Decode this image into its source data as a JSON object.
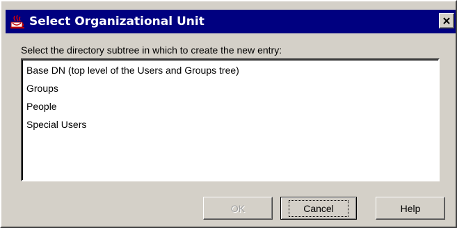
{
  "window": {
    "title": "Select Organizational Unit",
    "close_glyph": "close-icon",
    "app_icon": "java-app-icon"
  },
  "prompt": "Select the directory subtree in which to create the new entry:",
  "list": {
    "items": [
      {
        "label": "Base DN (top level of the Users and Groups tree)"
      },
      {
        "label": "Groups"
      },
      {
        "label": "People"
      },
      {
        "label": "Special Users"
      }
    ]
  },
  "buttons": {
    "ok": {
      "label": "OK",
      "enabled": false
    },
    "cancel": {
      "label": "Cancel",
      "enabled": true,
      "focused": true
    },
    "help": {
      "label": "Help",
      "enabled": true
    }
  },
  "colors": {
    "titlebar": "#000080",
    "face": "#d4d0c8"
  }
}
